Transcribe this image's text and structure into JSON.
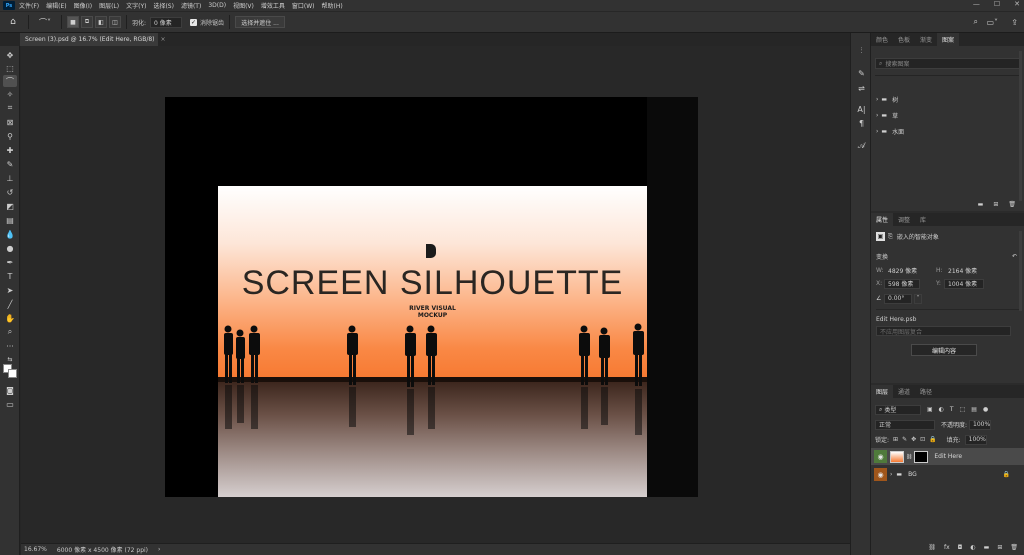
{
  "app": {
    "logo": "Ps"
  },
  "menu": [
    "文件(F)",
    "编辑(E)",
    "图像(I)",
    "图层(L)",
    "文字(Y)",
    "选择(S)",
    "滤镜(T)",
    "3D(D)",
    "视图(V)",
    "增效工具",
    "窗口(W)",
    "帮助(H)"
  ],
  "options": {
    "feather_label": "羽化:",
    "feather_value": "0 像素",
    "antialias_label": "消除锯齿",
    "select_mask_label": "选择并遮住 ..."
  },
  "document_tab": {
    "title": "Screen (3).psd @ 16.7% (Edit Here, RGB/8)",
    "close": "×"
  },
  "artwork": {
    "headline": "SCREEN SILHOUETTE",
    "sub_line1": "RIVER VISUAL",
    "sub_line2": "MOCKUP"
  },
  "status": {
    "zoom": "16.67%",
    "info": "6000 像素 x 4500 像素 (72 ppi)",
    "arrow": "›"
  },
  "top_panel": {
    "tabs": [
      "颜色",
      "色板",
      "渐变",
      "图案"
    ],
    "search_placeholder": "搜索图案",
    "folders": [
      "树",
      "草",
      "水面"
    ]
  },
  "properties_panel": {
    "tabs": [
      "属性",
      "调整",
      "库"
    ],
    "object_type": "嵌入的智能对象",
    "transform_label": "变换",
    "w_label": "W:",
    "w_value": "4829 像素",
    "h_label": "H:",
    "h_value": "2164 像素",
    "x_label": "X:",
    "x_value": "598 像素",
    "y_label": "Y:",
    "y_value": "1004 像素",
    "angle_value": "0.00°",
    "file_name": "Edit Here.psb",
    "comp_placeholder": "不应用图层复合",
    "edit_button": "编辑内容"
  },
  "layers_panel": {
    "tabs": [
      "图层",
      "通道",
      "路径"
    ],
    "kind_filter": "类型",
    "blend_mode": "正常",
    "opacity_label": "不透明度:",
    "opacity_value": "100%",
    "lock_label": "锁定:",
    "fill_label": "填充:",
    "fill_value": "100%",
    "layers": [
      {
        "name": "Edit Here",
        "type": "smart-object"
      },
      {
        "name": "BG",
        "type": "group"
      }
    ]
  }
}
